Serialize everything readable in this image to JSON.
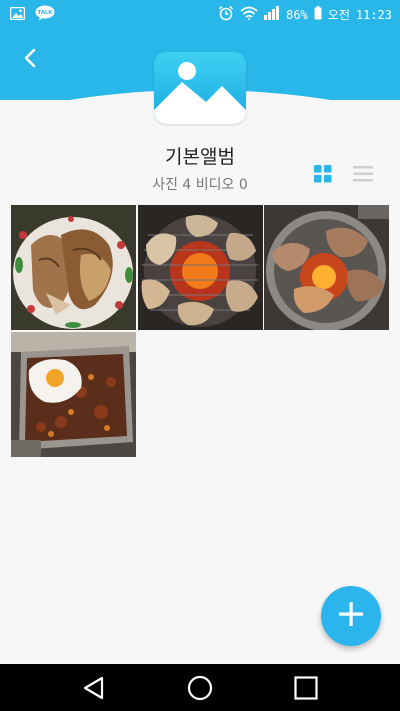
{
  "status_bar": {
    "battery": "86%",
    "ampm": "오전",
    "time": "11:23",
    "icons": [
      "gallery-icon",
      "kakaotalk-icon",
      "alarm-icon",
      "wifi-icon",
      "signal-icon",
      "battery-icon"
    ],
    "talk_badge": "TALK"
  },
  "header": {
    "back_icon": "chevron-left-icon",
    "accent_color": "#29b6e8"
  },
  "album": {
    "title": "기본앨범",
    "count_text": "사진 4 비디오 0",
    "thumbnail_icon": "image-placeholder-icon"
  },
  "view_toggle": {
    "grid_icon": "grid-view-icon",
    "list_icon": "list-view-icon",
    "active": "grid"
  },
  "photos": [
    {
      "id": "photo-1",
      "subject": "grilled fish on patterned plate"
    },
    {
      "id": "photo-2",
      "subject": "meat grilling over charcoal"
    },
    {
      "id": "photo-3",
      "subject": "meat on round grill pan"
    },
    {
      "id": "photo-4",
      "subject": "fried egg on stir-fry in tray"
    }
  ],
  "fab": {
    "icon": "plus-icon",
    "color": "#2bb5ec"
  },
  "nav_bar": {
    "back_icon": "nav-back-icon",
    "home_icon": "nav-home-icon",
    "recents_icon": "nav-recents-icon"
  }
}
